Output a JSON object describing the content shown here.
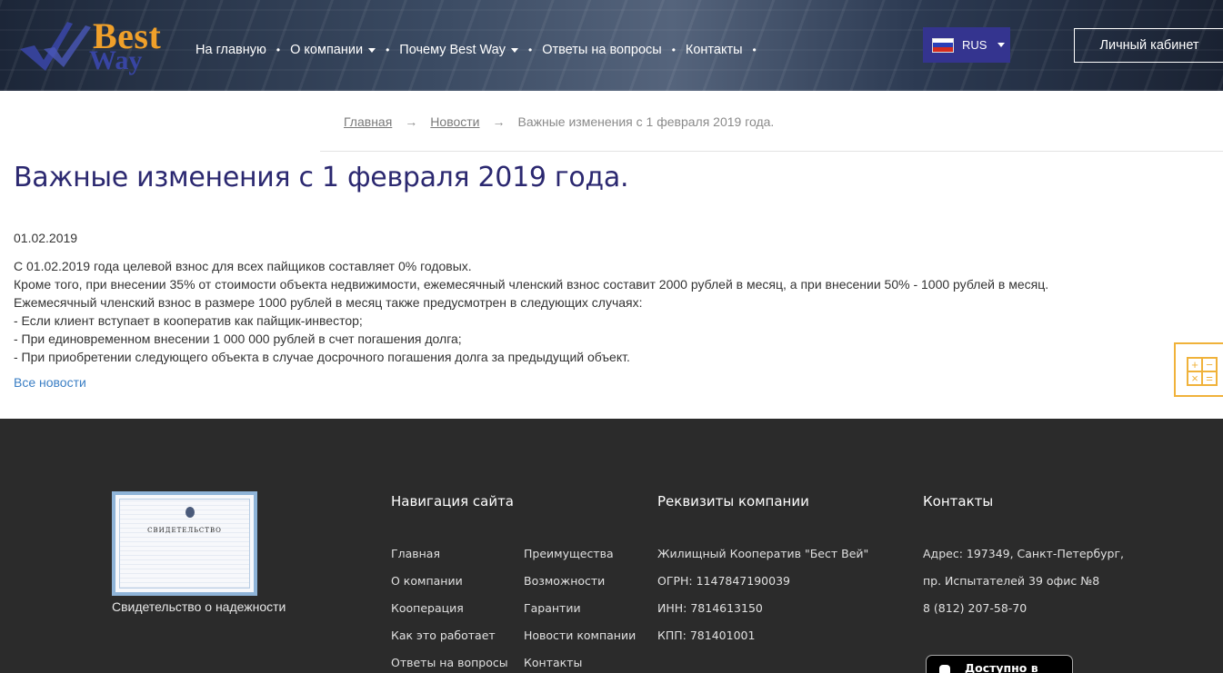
{
  "header": {
    "logo": {
      "best": "Best",
      "way": "Way"
    },
    "nav": [
      {
        "label": "На главную",
        "dropdown": false
      },
      {
        "label": "О компании",
        "dropdown": true
      },
      {
        "label": "Почему Best Way",
        "dropdown": true
      },
      {
        "label": "Ответы на вопросы",
        "dropdown": false
      },
      {
        "label": "Контакты",
        "dropdown": false
      }
    ],
    "language": "RUS",
    "cabinet_label": "Личный кабинет"
  },
  "breadcrumb": {
    "home": "Главная",
    "news": "Новости",
    "current": "Важные изменения с 1 февраля 2019 года.",
    "arrow": "→"
  },
  "article": {
    "title": "Важные изменения с 1 февраля 2019 года.",
    "date": "01.02.2019",
    "lines": [
      "С 01.02.2019 года целевой взнос для всех пайщиков составляет 0% годовых.",
      "Кроме того, при внесении 35% от стоимости объекта недвижимости, ежемесячный членский взнос составит 2000 рублей в месяц, а при внесении 50% - 1000 рублей в месяц.",
      "Ежемесячный членский взнос в размере 1000 рублей в месяц также предусмотрен в следующих случаях:",
      "- Если клиент вступает в кооператив как пайщик-инвестор;",
      "- При единовременном внесении 1 000 000 рублей в счет погашения долга;",
      "- При приобретении следующего объекта в случае досрочного погашения долга за предыдущий объект."
    ],
    "all_news": "Все новости"
  },
  "calculator": {
    "symbols": [
      "+",
      "−",
      "×",
      "="
    ]
  },
  "footer": {
    "certificate": {
      "title": "СВИДЕТЕЛЬСТВО",
      "caption": "Свидетельство о надежности"
    },
    "navigation": {
      "title": "Навигация сайта",
      "col1": [
        "Главная",
        "О компании",
        "Кооперация",
        "Как это работает",
        "Ответы на вопросы"
      ],
      "col2": [
        "Преимущества",
        "Возможности",
        "Гарантии",
        "Новости компании",
        "Контакты"
      ]
    },
    "requisites": {
      "title": "Реквизиты компании",
      "lines": [
        "Жилищный Кооператив \"Бест Вей\"",
        "ОГРН: 1147847190039",
        "ИНН: 7814613150",
        "КПП: 781401001"
      ]
    },
    "contacts": {
      "title": "Контакты",
      "lines": [
        "Адрес: 197349, Санкт-Петербург,",
        "пр. Испытателей 39 офис №8",
        "8 (812) 207-58-70"
      ],
      "appstore": "Доступно в"
    }
  },
  "colors": {
    "accent": "#2b2870",
    "link": "#3a7ec4",
    "lang_bg": "#34348f",
    "calc": "#f0b23a",
    "footer_bg": "#2b2b2b"
  }
}
